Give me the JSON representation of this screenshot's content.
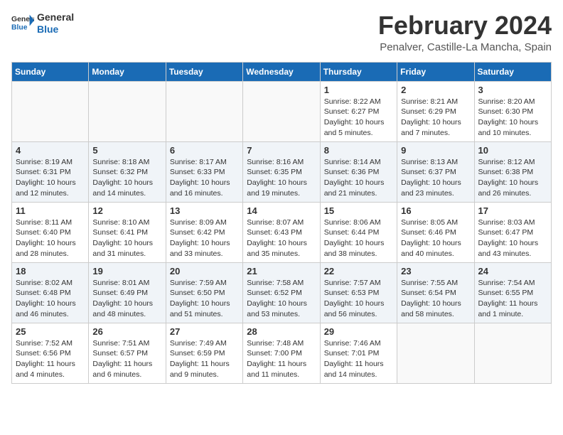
{
  "header": {
    "logo_line1": "General",
    "logo_line2": "Blue",
    "month_year": "February 2024",
    "location": "Penalver, Castille-La Mancha, Spain"
  },
  "weekdays": [
    "Sunday",
    "Monday",
    "Tuesday",
    "Wednesday",
    "Thursday",
    "Friday",
    "Saturday"
  ],
  "weeks": [
    [
      {
        "day": "",
        "info": ""
      },
      {
        "day": "",
        "info": ""
      },
      {
        "day": "",
        "info": ""
      },
      {
        "day": "",
        "info": ""
      },
      {
        "day": "1",
        "info": "Sunrise: 8:22 AM\nSunset: 6:27 PM\nDaylight: 10 hours\nand 5 minutes."
      },
      {
        "day": "2",
        "info": "Sunrise: 8:21 AM\nSunset: 6:29 PM\nDaylight: 10 hours\nand 7 minutes."
      },
      {
        "day": "3",
        "info": "Sunrise: 8:20 AM\nSunset: 6:30 PM\nDaylight: 10 hours\nand 10 minutes."
      }
    ],
    [
      {
        "day": "4",
        "info": "Sunrise: 8:19 AM\nSunset: 6:31 PM\nDaylight: 10 hours\nand 12 minutes."
      },
      {
        "day": "5",
        "info": "Sunrise: 8:18 AM\nSunset: 6:32 PM\nDaylight: 10 hours\nand 14 minutes."
      },
      {
        "day": "6",
        "info": "Sunrise: 8:17 AM\nSunset: 6:33 PM\nDaylight: 10 hours\nand 16 minutes."
      },
      {
        "day": "7",
        "info": "Sunrise: 8:16 AM\nSunset: 6:35 PM\nDaylight: 10 hours\nand 19 minutes."
      },
      {
        "day": "8",
        "info": "Sunrise: 8:14 AM\nSunset: 6:36 PM\nDaylight: 10 hours\nand 21 minutes."
      },
      {
        "day": "9",
        "info": "Sunrise: 8:13 AM\nSunset: 6:37 PM\nDaylight: 10 hours\nand 23 minutes."
      },
      {
        "day": "10",
        "info": "Sunrise: 8:12 AM\nSunset: 6:38 PM\nDaylight: 10 hours\nand 26 minutes."
      }
    ],
    [
      {
        "day": "11",
        "info": "Sunrise: 8:11 AM\nSunset: 6:40 PM\nDaylight: 10 hours\nand 28 minutes."
      },
      {
        "day": "12",
        "info": "Sunrise: 8:10 AM\nSunset: 6:41 PM\nDaylight: 10 hours\nand 31 minutes."
      },
      {
        "day": "13",
        "info": "Sunrise: 8:09 AM\nSunset: 6:42 PM\nDaylight: 10 hours\nand 33 minutes."
      },
      {
        "day": "14",
        "info": "Sunrise: 8:07 AM\nSunset: 6:43 PM\nDaylight: 10 hours\nand 35 minutes."
      },
      {
        "day": "15",
        "info": "Sunrise: 8:06 AM\nSunset: 6:44 PM\nDaylight: 10 hours\nand 38 minutes."
      },
      {
        "day": "16",
        "info": "Sunrise: 8:05 AM\nSunset: 6:46 PM\nDaylight: 10 hours\nand 40 minutes."
      },
      {
        "day": "17",
        "info": "Sunrise: 8:03 AM\nSunset: 6:47 PM\nDaylight: 10 hours\nand 43 minutes."
      }
    ],
    [
      {
        "day": "18",
        "info": "Sunrise: 8:02 AM\nSunset: 6:48 PM\nDaylight: 10 hours\nand 46 minutes."
      },
      {
        "day": "19",
        "info": "Sunrise: 8:01 AM\nSunset: 6:49 PM\nDaylight: 10 hours\nand 48 minutes."
      },
      {
        "day": "20",
        "info": "Sunrise: 7:59 AM\nSunset: 6:50 PM\nDaylight: 10 hours\nand 51 minutes."
      },
      {
        "day": "21",
        "info": "Sunrise: 7:58 AM\nSunset: 6:52 PM\nDaylight: 10 hours\nand 53 minutes."
      },
      {
        "day": "22",
        "info": "Sunrise: 7:57 AM\nSunset: 6:53 PM\nDaylight: 10 hours\nand 56 minutes."
      },
      {
        "day": "23",
        "info": "Sunrise: 7:55 AM\nSunset: 6:54 PM\nDaylight: 10 hours\nand 58 minutes."
      },
      {
        "day": "24",
        "info": "Sunrise: 7:54 AM\nSunset: 6:55 PM\nDaylight: 11 hours\nand 1 minute."
      }
    ],
    [
      {
        "day": "25",
        "info": "Sunrise: 7:52 AM\nSunset: 6:56 PM\nDaylight: 11 hours\nand 4 minutes."
      },
      {
        "day": "26",
        "info": "Sunrise: 7:51 AM\nSunset: 6:57 PM\nDaylight: 11 hours\nand 6 minutes."
      },
      {
        "day": "27",
        "info": "Sunrise: 7:49 AM\nSunset: 6:59 PM\nDaylight: 11 hours\nand 9 minutes."
      },
      {
        "day": "28",
        "info": "Sunrise: 7:48 AM\nSunset: 7:00 PM\nDaylight: 11 hours\nand 11 minutes."
      },
      {
        "day": "29",
        "info": "Sunrise: 7:46 AM\nSunset: 7:01 PM\nDaylight: 11 hours\nand 14 minutes."
      },
      {
        "day": "",
        "info": ""
      },
      {
        "day": "",
        "info": ""
      }
    ]
  ]
}
